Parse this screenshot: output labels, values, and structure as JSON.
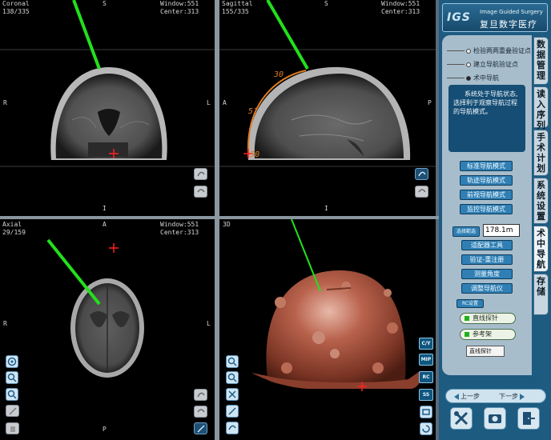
{
  "viewports": {
    "coronal": {
      "name": "Coronal",
      "slice": "138/335",
      "window": "Window:551",
      "center": "Center:313",
      "top": "S",
      "bottom": "I",
      "left": "R",
      "right": "L"
    },
    "sagittal": {
      "name": "Sagittal",
      "slice": "155/335",
      "window": "Window:551",
      "center": "Center:313",
      "top": "S",
      "bottom": "I",
      "left": "A",
      "right": "P",
      "marks": [
        "30",
        "51",
        "50"
      ]
    },
    "axial": {
      "name": "Axial",
      "slice": "29/159",
      "window": "Window:551",
      "center": "Center:313",
      "top": "A",
      "bottom": "P",
      "left": "R",
      "right": "L"
    },
    "volume3d": {
      "name": "3D",
      "buttons": [
        "C/Y",
        "MIP",
        "RC",
        "SS"
      ]
    }
  },
  "panel": {
    "logo_abbr": "IGS",
    "logo_en": "Image Guided Surgery",
    "logo_cn": "复旦数字医疗",
    "options": [
      "检验两两重叠验证点",
      "建立导航验证点",
      "术中导航"
    ],
    "selected_option": 2,
    "info": "系统处于导航状态,选择利于观察导航过程的导航模式。",
    "mode_buttons": [
      "标准导航模式",
      "轨迹导航模式",
      "前视导航模式",
      "监控导航模式"
    ],
    "range_label": "选择範选",
    "range_value": "178.1m",
    "tool_buttons": [
      "适配器工具",
      "验证-重注册",
      "测量角度",
      "调整导航仪"
    ],
    "rc_label": "RC设置",
    "probe_straight": "直线探针",
    "reference_frame": "参考架",
    "probe_field": "直线探针",
    "prev_step": "上一步",
    "next_step": "下一步",
    "tabs": [
      "数据管理",
      "读入序列",
      "手术计划",
      "系统设置",
      "术中导航",
      "存储"
    ]
  },
  "colors": {
    "accent": "#1d5b80",
    "probe": "#22e01c",
    "skull3d": "#9a4a38"
  }
}
